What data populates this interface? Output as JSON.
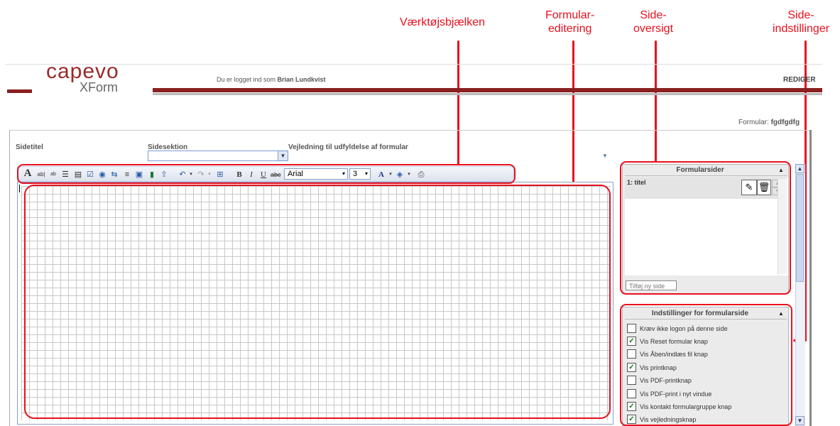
{
  "callouts": {
    "toolbar": "Værktøjsbjælken",
    "form_editing": [
      "Formular-",
      "editering"
    ],
    "page_overview": [
      "Side-",
      "oversigt"
    ],
    "page_settings": [
      "Side-",
      "indstillinger"
    ]
  },
  "header": {
    "logo_main": "capevo",
    "logo_sub": "XForm",
    "logged_in_prefix": "Du er logget ind som ",
    "user_name": "Brian Lundkvist",
    "mode": "REDIGER",
    "form_label": "Formular: ",
    "form_name": "fgdfgdfg"
  },
  "fields": {
    "page_title_label": "Sidetitel",
    "page_section_label": "Sidesektion",
    "guidance_label": "Vejledning til udfyldelse af formular"
  },
  "toolbar": {
    "font_name": "Arial",
    "font_size": "3",
    "icons": [
      "text-icon",
      "textfield-icon",
      "textarea-icon",
      "listbox-icon",
      "dropdown-icon",
      "checkbox-icon",
      "radio-icon",
      "button-field-icon",
      "align-icon",
      "frame-icon",
      "color-block-icon",
      "upload-icon",
      "undo-icon",
      "redo-icon",
      "grid-icon",
      "bold-icon",
      "italic-icon",
      "underline-icon",
      "strikethrough-icon",
      "font-color-icon",
      "highlight-icon",
      "print-icon"
    ]
  },
  "pages_panel": {
    "title": "Formularsider",
    "pages": [
      "1: titel"
    ],
    "add_page_label": "Tilføj ny side"
  },
  "settings_panel": {
    "title": "Indstillinger for formularside",
    "options": [
      {
        "label": "Kræv ikke logon på denne side",
        "checked": false
      },
      {
        "label": "Vis Reset formular knap",
        "checked": true
      },
      {
        "label": "Vis Åben/indlæs fil knap",
        "checked": false
      },
      {
        "label": "Vis printknap",
        "checked": true
      },
      {
        "label": "Vis PDF-printknap",
        "checked": false
      },
      {
        "label": "Vis PDF-print i nyt vindue",
        "checked": false
      },
      {
        "label": "Vis kontakt formulargruppe knap",
        "checked": true
      },
      {
        "label": "Vis vejledningsknap",
        "checked": true
      }
    ]
  },
  "colors": {
    "accent_red": "#e8101e",
    "header_dark": "#8a2020",
    "panel_bg": "#ebebeb"
  }
}
